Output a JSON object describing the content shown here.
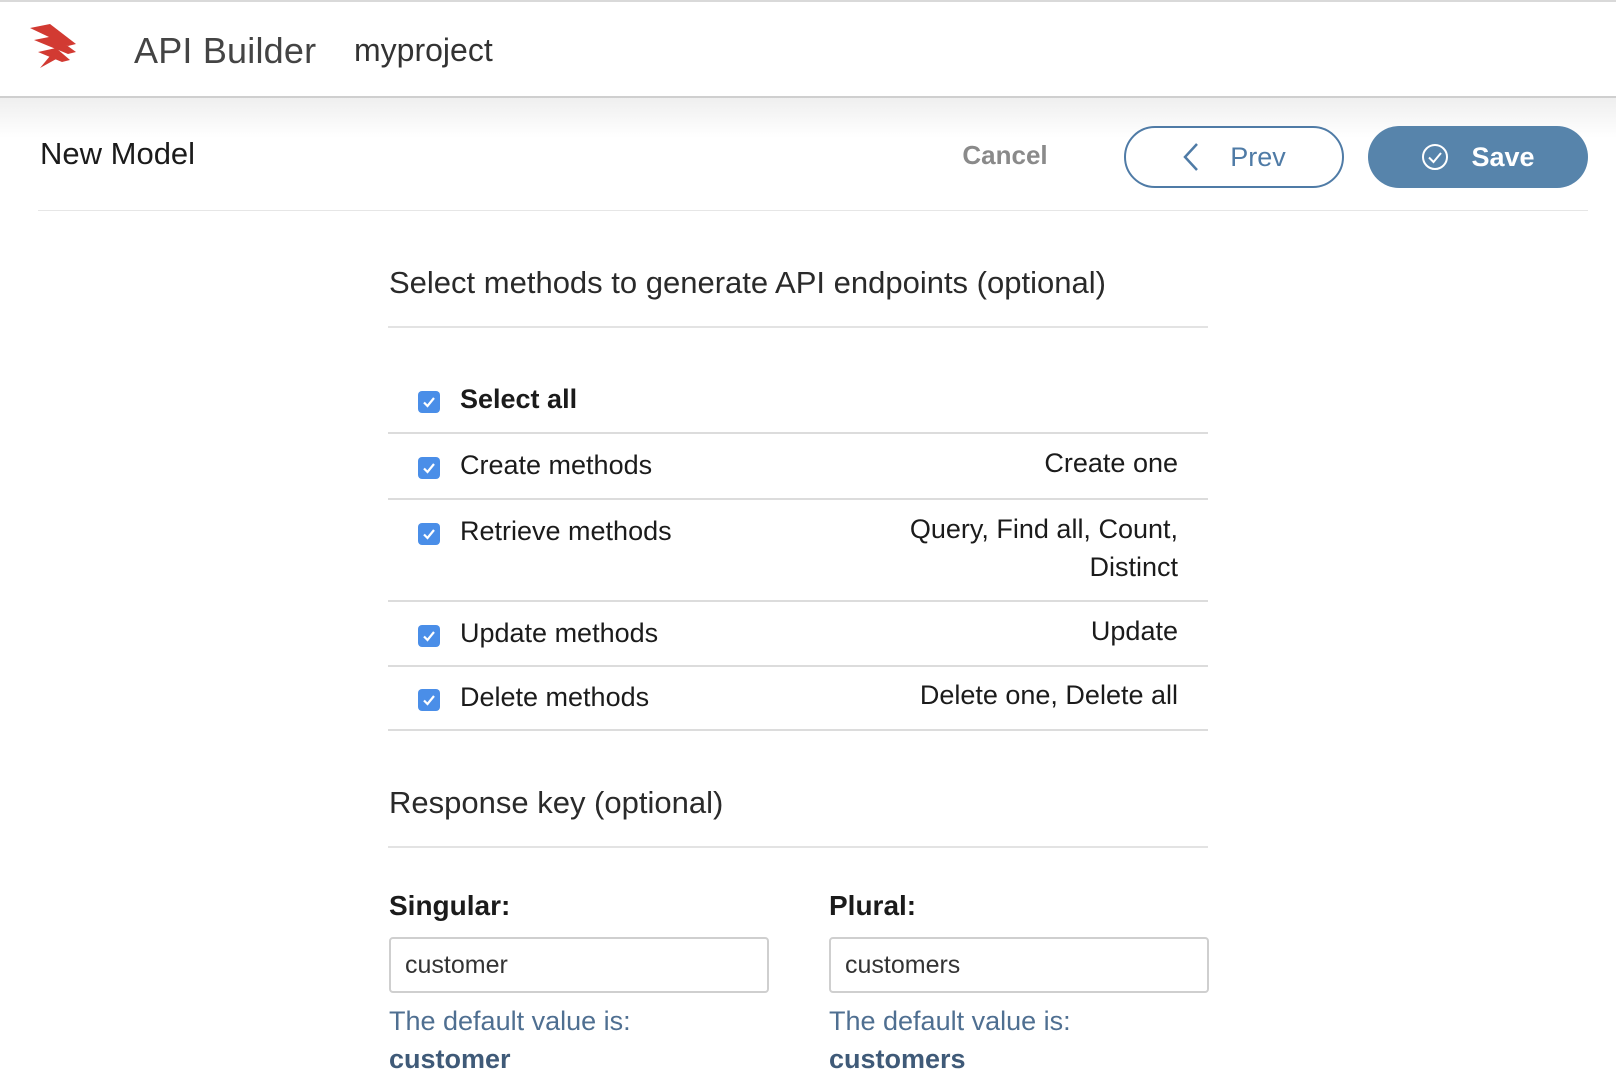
{
  "header": {
    "app_name": "API Builder",
    "project_name": "myproject",
    "brand_color": "#d23a32"
  },
  "toolbar": {
    "title": "New Model",
    "cancel_label": "Cancel",
    "prev_label": "Prev",
    "save_label": "Save",
    "accent_color": "#5784ab"
  },
  "methods": {
    "title": "Select methods to generate API endpoints (optional)",
    "select_all": {
      "label": "Select all",
      "checked": true
    },
    "rows": [
      {
        "label": "Create methods",
        "desc": "Create one",
        "checked": true
      },
      {
        "label": "Retrieve methods",
        "desc": "Query, Find all, Count, Distinct",
        "checked": true
      },
      {
        "label": "Update methods",
        "desc": "Update",
        "checked": true
      },
      {
        "label": "Delete methods",
        "desc": "Delete one, Delete all",
        "checked": true
      }
    ]
  },
  "response_key": {
    "title": "Response key (optional)",
    "singular": {
      "label": "Singular:",
      "value": "customer",
      "default_note": "The default value is:",
      "default_value": "customer"
    },
    "plural": {
      "label": "Plural:",
      "value": "customers",
      "default_note": "The default value is:",
      "default_value": "customers"
    }
  }
}
